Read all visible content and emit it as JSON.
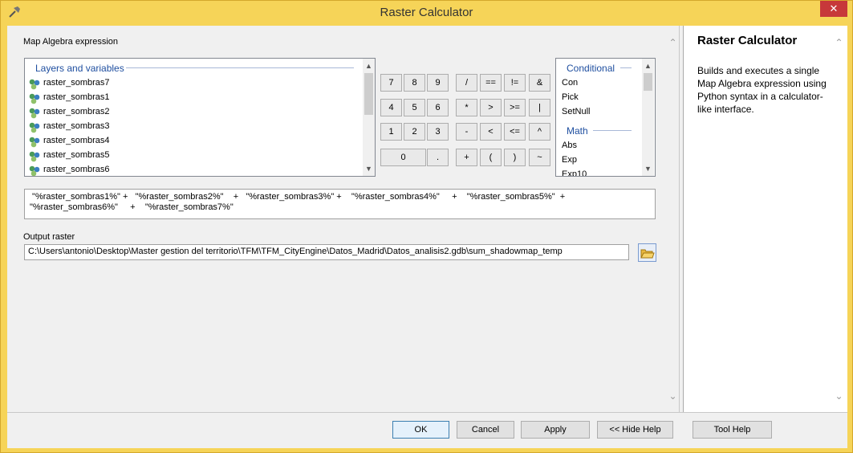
{
  "window": {
    "title": "Raster Calculator",
    "close_glyph": "✕"
  },
  "main": {
    "expression_label": "Map Algebra expression",
    "layers": {
      "header": "Layers and variables",
      "items": [
        "raster_sombras7",
        "raster_sombras1",
        "raster_sombras2",
        "raster_sombras3",
        "raster_sombras4",
        "raster_sombras5",
        "raster_sombras6"
      ]
    },
    "keypad": {
      "rows": [
        [
          "7",
          "8",
          "9",
          "/",
          "==",
          "!=",
          "&"
        ],
        [
          "4",
          "5",
          "6",
          "*",
          ">",
          ">=",
          "|"
        ],
        [
          "1",
          "2",
          "3",
          "-",
          "<",
          "<=",
          "^"
        ],
        [
          "0",
          ".",
          "+",
          "(",
          ")",
          "~"
        ]
      ]
    },
    "functions": {
      "conditional_header": "Conditional",
      "conditional": [
        "Con",
        "Pick",
        "SetNull"
      ],
      "math_header": "Math",
      "math": [
        "Abs",
        "Exp",
        "Exp10"
      ]
    },
    "expression_line1": " \"%raster_sombras1%\" +   \"%raster_sombras2%\"    +   \"%raster_sombras3%\" +    \"%raster_sombras4%\"     +    \"%raster_sombras5%\"  +",
    "expression_line2": "\"%raster_sombras6%\"     +    \"%raster_sombras7%\"",
    "output_label": "Output raster",
    "output_value": "C:\\Users\\antonio\\Desktop\\Master gestion del territorio\\TFM\\TFM_CityEngine\\Datos_Madrid\\Datos_analisis2.gdb\\sum_shadowmap_temp"
  },
  "help": {
    "title": "Raster Calculator",
    "text": "Builds and executes a single Map Algebra expression using Python syntax in a calculator-like interface."
  },
  "footer": {
    "ok": "OK",
    "cancel": "Cancel",
    "apply": "Apply",
    "hide_help": "<< Hide Help",
    "tool_help": "Tool Help"
  },
  "colors": {
    "titlebar": "#f6d458",
    "close": "#c7383a",
    "group_header": "#1f4fa0"
  }
}
